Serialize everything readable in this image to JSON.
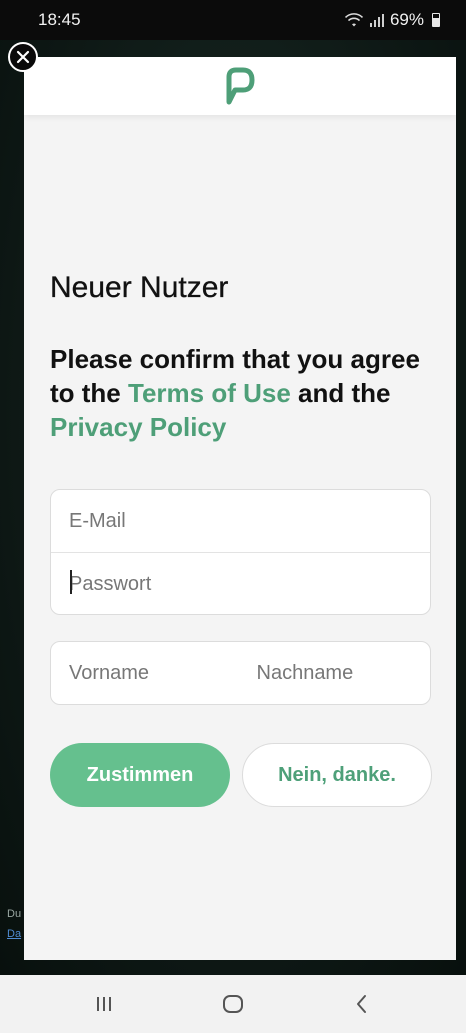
{
  "status_bar": {
    "time": "18:45",
    "battery": "69%",
    "icons": [
      "wifi-icon",
      "signal-icon",
      "battery-icon"
    ]
  },
  "background_page": {
    "snippet_1": "Du",
    "snippet_2": "Da"
  },
  "modal": {
    "logo_icon": "p-logo-icon",
    "close_icon": "close-icon",
    "title": "Neuer Nutzer",
    "consent": {
      "text_before": "Please confirm that you agree to the ",
      "terms_link": "Terms of Use",
      "text_middle": " and the ",
      "privacy_link": "Privacy Policy"
    },
    "form": {
      "email_placeholder": "E-Mail",
      "email_value": "",
      "password_placeholder": "Passwort",
      "password_value": "",
      "firstname_placeholder": "Vorname",
      "firstname_value": "",
      "lastname_placeholder": "Nachname",
      "lastname_value": ""
    },
    "buttons": {
      "agree_label": "Zustimmen",
      "decline_label": "Nein, danke."
    }
  },
  "nav_bar": {
    "icons": [
      "recent-apps-icon",
      "home-icon",
      "back-icon"
    ]
  },
  "colors": {
    "brand_green": "#4e9f78",
    "button_green": "#65c08e",
    "modal_background": "#f4f4f4"
  }
}
